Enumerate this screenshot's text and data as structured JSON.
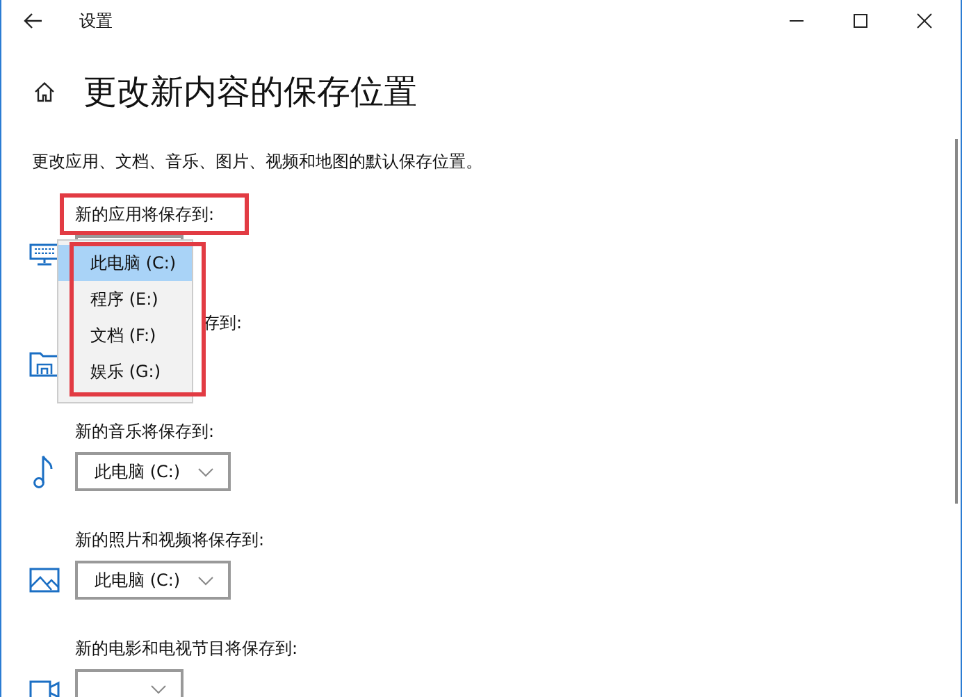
{
  "window": {
    "title": "设置"
  },
  "page": {
    "title": "更改新内容的保存位置",
    "description": "更改应用、文档、音乐、图片、视频和地图的默认保存位置。"
  },
  "sections": [
    {
      "label": "新的应用将保存到:",
      "kind": "full"
    },
    {
      "label": "存到:",
      "kind": "partial"
    },
    {
      "label": "新的音乐将保存到:",
      "kind": "full",
      "value": "此电脑 (C:)"
    },
    {
      "label": "新的照片和视频将保存到:",
      "kind": "full",
      "value": "此电脑 (C:)"
    },
    {
      "label": "新的电影和电视节目将保存到:",
      "kind": "full"
    }
  ],
  "first_label_highlighted": true,
  "dropdown": {
    "highlighted": true,
    "options": [
      {
        "label": "此电脑 (C:)",
        "selected": true
      },
      {
        "label": "程序 (E:)",
        "selected": false
      },
      {
        "label": "文档 (F:)",
        "selected": false
      },
      {
        "label": "娱乐 (G:)",
        "selected": false
      }
    ]
  }
}
